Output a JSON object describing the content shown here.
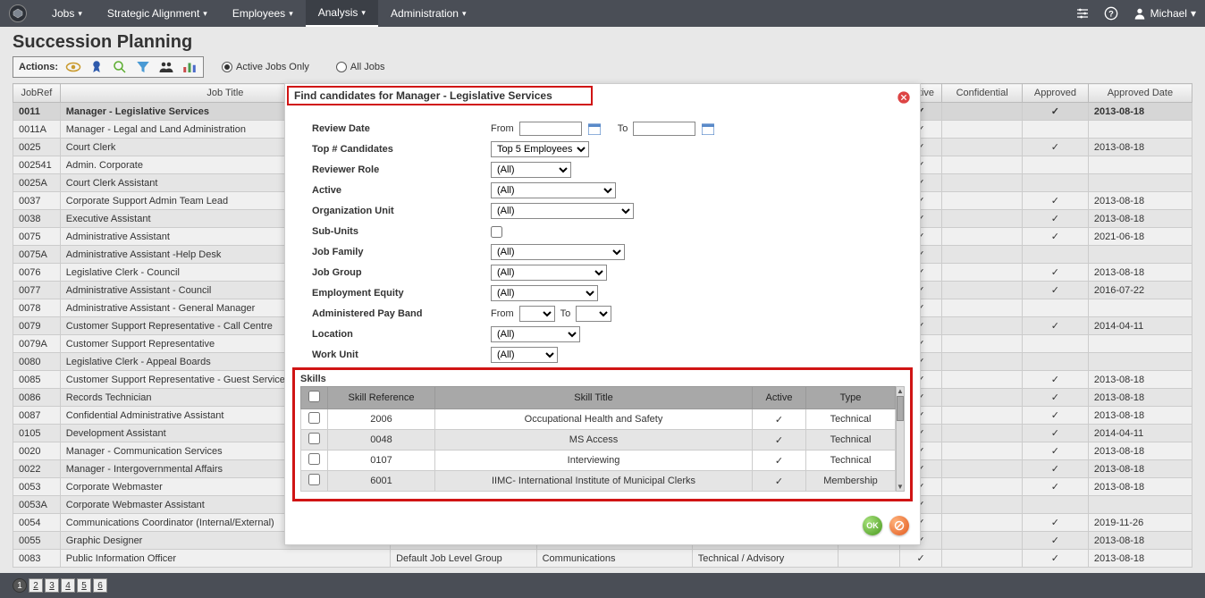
{
  "nav": {
    "items": [
      "Jobs",
      "Strategic Alignment",
      "Employees",
      "Analysis",
      "Administration"
    ],
    "active_index": 3,
    "user": "Michael"
  },
  "page": {
    "title": "Succession Planning",
    "actions_label": "Actions:",
    "filter_active": "Active Jobs Only",
    "filter_all": "All Jobs",
    "filter_selected": "active"
  },
  "jobs_table": {
    "headers": [
      "JobRef",
      "Job Title",
      "",
      "",
      "",
      "",
      "Active",
      "Confidential",
      "Approved",
      "Approved Date"
    ],
    "extra_headers_row": [
      "",
      "",
      "Default Job Level Group",
      "Communications",
      "Technical / Advisory",
      "",
      "",
      "",
      "",
      ""
    ],
    "rows": [
      {
        "ref": "0011",
        "title": "Manager - Legislative Services",
        "active": true,
        "conf": false,
        "appr": true,
        "date": "2013-08-18",
        "sel": true
      },
      {
        "ref": "0011A",
        "title": "Manager - Legal and Land Administration",
        "active": true,
        "conf": false,
        "appr": false,
        "date": ""
      },
      {
        "ref": "0025",
        "title": "Court Clerk",
        "active": true,
        "conf": false,
        "appr": true,
        "date": "2013-08-18"
      },
      {
        "ref": "002541",
        "title": "Admin. Corporate",
        "active": true,
        "conf": false,
        "appr": false,
        "date": ""
      },
      {
        "ref": "0025A",
        "title": "Court Clerk Assistant",
        "active": true,
        "conf": false,
        "appr": false,
        "date": ""
      },
      {
        "ref": "0037",
        "title": "Corporate Support Admin Team Lead",
        "active": true,
        "conf": false,
        "appr": true,
        "date": "2013-08-18"
      },
      {
        "ref": "0038",
        "title": "Executive Assistant",
        "active": true,
        "conf": false,
        "appr": true,
        "date": "2013-08-18"
      },
      {
        "ref": "0075",
        "title": "Administrative Assistant",
        "active": true,
        "conf": false,
        "appr": true,
        "date": "2021-06-18"
      },
      {
        "ref": "0075A",
        "title": "Administrative Assistant -Help Desk",
        "active": true,
        "conf": false,
        "appr": false,
        "date": ""
      },
      {
        "ref": "0076",
        "title": "Legislative Clerk - Council",
        "active": true,
        "conf": false,
        "appr": true,
        "date": "2013-08-18"
      },
      {
        "ref": "0077",
        "title": "Administrative Assistant - Council",
        "active": true,
        "conf": false,
        "appr": true,
        "date": "2016-07-22"
      },
      {
        "ref": "0078",
        "title": "Administrative Assistant - General Manager",
        "active": true,
        "conf": false,
        "appr": false,
        "date": ""
      },
      {
        "ref": "0079",
        "title": "Customer Support Representative - Call Centre",
        "active": true,
        "conf": false,
        "appr": true,
        "date": "2014-04-11"
      },
      {
        "ref": "0079A",
        "title": "Customer Support Representative",
        "active": true,
        "conf": false,
        "appr": false,
        "date": ""
      },
      {
        "ref": "0080",
        "title": "Legislative Clerk - Appeal Boards",
        "active": true,
        "conf": false,
        "appr": false,
        "date": ""
      },
      {
        "ref": "0085",
        "title": "Customer Support Representative - Guest Services",
        "active": true,
        "conf": false,
        "appr": true,
        "date": "2013-08-18"
      },
      {
        "ref": "0086",
        "title": "Records Technician",
        "active": true,
        "conf": false,
        "appr": true,
        "date": "2013-08-18"
      },
      {
        "ref": "0087",
        "title": "Confidential Administrative Assistant",
        "active": true,
        "conf": false,
        "appr": true,
        "date": "2013-08-18"
      },
      {
        "ref": "0105",
        "title": "Development Assistant",
        "active": true,
        "conf": false,
        "appr": true,
        "date": "2014-04-11"
      },
      {
        "ref": "0020",
        "title": "Manager - Communication Services",
        "active": true,
        "conf": false,
        "appr": true,
        "date": "2013-08-18"
      },
      {
        "ref": "0022",
        "title": "Manager - Intergovernmental Affairs",
        "active": true,
        "conf": false,
        "appr": true,
        "date": "2013-08-18"
      },
      {
        "ref": "0053",
        "title": "Corporate Webmaster",
        "active": true,
        "conf": false,
        "appr": true,
        "date": "2013-08-18"
      },
      {
        "ref": "0053A",
        "title": "Corporate Webmaster Assistant",
        "active": true,
        "conf": false,
        "appr": false,
        "date": ""
      },
      {
        "ref": "0054",
        "title": "Communications Coordinator (Internal/External)",
        "active": true,
        "conf": false,
        "appr": true,
        "date": "2019-11-26"
      },
      {
        "ref": "0055",
        "title": "Graphic Designer",
        "active": true,
        "conf": false,
        "appr": true,
        "date": "2013-08-18"
      },
      {
        "ref": "0083",
        "title": "Public Information Officer",
        "active": true,
        "conf": false,
        "appr": true,
        "date": "2013-08-18",
        "show_extra": true
      }
    ]
  },
  "modal": {
    "title": "Find candidates for Manager - Legislative Services",
    "fields": {
      "review_date": "Review Date",
      "from": "From",
      "to": "To",
      "top_candidates": "Top # Candidates",
      "top_candidates_value": "Top 5 Employees",
      "reviewer_role": "Reviewer Role",
      "active": "Active",
      "org_unit": "Organization Unit",
      "sub_units": "Sub-Units",
      "job_family": "Job Family",
      "job_group": "Job Group",
      "emp_equity": "Employment Equity",
      "pay_band": "Administered Pay Band",
      "location": "Location",
      "work_unit": "Work Unit",
      "all": "(All)"
    },
    "skills": {
      "label": "Skills",
      "headers": [
        "",
        "Skill Reference",
        "Skill Title",
        "Active",
        "Type"
      ],
      "rows": [
        {
          "ref": "2006",
          "title": "Occupational Health and Safety",
          "active": true,
          "type": "Technical"
        },
        {
          "ref": "0048",
          "title": "MS Access",
          "active": true,
          "type": "Technical"
        },
        {
          "ref": "0107",
          "title": "Interviewing",
          "active": true,
          "type": "Technical"
        },
        {
          "ref": "6001",
          "title": "IIMC- International Institute of Municipal Clerks",
          "active": true,
          "type": "Membership"
        }
      ]
    },
    "footer": {
      "ok": "OK"
    }
  },
  "pagination": [
    "1",
    "2",
    "3",
    "4",
    "5",
    "6"
  ]
}
